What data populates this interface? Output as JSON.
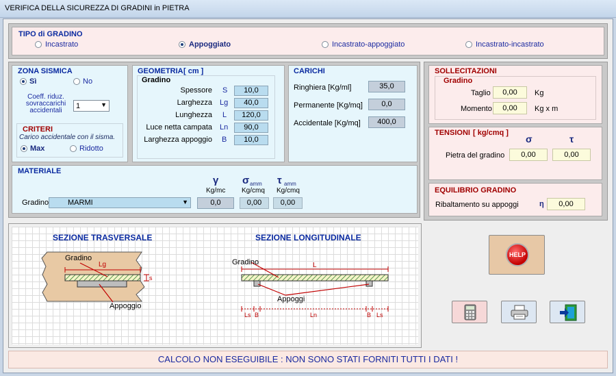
{
  "window": {
    "title": "VERIFICA DELLA SICUREZZA DI GRADINI in PIETRA"
  },
  "tipo": {
    "header": "TIPO di GRADINO",
    "options": [
      "Incastrato",
      "Appoggiato",
      "Incastrato-appoggiato",
      "Incastrato-incastrato"
    ],
    "selected": "Appoggiato"
  },
  "zona": {
    "header": "ZONA SISMICA",
    "si": "Sì",
    "no": "No",
    "coeff_label": "Coeff. riduz. sovraccarichi accidentali",
    "coeff_value": "1"
  },
  "criteri": {
    "header": "CRITERI",
    "subtitle": "Carico accidentale con il sisma.",
    "max": "Max",
    "ridotto": "Ridotto"
  },
  "geometria": {
    "header": "GEOMETRIA",
    "unit": "[ cm ]",
    "sub": "Gradino",
    "rows": [
      {
        "label": "Spessore",
        "sym": "S",
        "value": "10,0"
      },
      {
        "label": "Larghezza",
        "sym": "Lg",
        "value": "40,0"
      },
      {
        "label": "Lunghezza",
        "sym": "L",
        "value": "120,0"
      },
      {
        "label": "Luce netta campata",
        "sym": "Ln",
        "value": "90,0"
      },
      {
        "label": "Larghezza appoggio",
        "sym": "B",
        "value": "10,0"
      }
    ]
  },
  "carichi": {
    "header": "CARICHI",
    "rows": [
      {
        "label": "Ringhiera [Kg/ml]",
        "value": "35,0"
      },
      {
        "label": "Permanente [Kg/mq]",
        "value": "0,0"
      },
      {
        "label": "Accidentale [Kg/mq]",
        "value": "400,0"
      }
    ]
  },
  "materiale": {
    "header": "MATERIALE",
    "label": "Gradino",
    "value": "MARMI",
    "col1_sym": "γ",
    "col1_unit": "Kg/mc",
    "col2_sym": "σ",
    "col2_sub": "amm",
    "col2_unit": "Kg/cmq",
    "col3_sym": "τ",
    "col3_sub": "amm",
    "col3_unit": "Kg/cmq",
    "v1": "0,0",
    "v2": "0,00",
    "v3": "0,00"
  },
  "sollecitazioni": {
    "header": "SOLLECITAZIONI",
    "sub": "Gradino",
    "taglio_label": "Taglio",
    "taglio_value": "0,00",
    "taglio_unit": "Kg",
    "momento_label": "Momento",
    "momento_value": "0,00",
    "momento_unit": "Kg x m"
  },
  "tensioni": {
    "header": "TENSIONI",
    "unit": "[ kg/cmq ]",
    "sigma": "σ",
    "tau": "τ",
    "row_label": "Pietra del gradino",
    "sigma_value": "0,00",
    "tau_value": "0,00"
  },
  "equilibrio": {
    "header": "EQUILIBRIO GRADINO",
    "label": "Ribaltamento su appoggi",
    "sym": "η",
    "value": "0,00"
  },
  "diagram": {
    "trasv_title": "SEZIONE TRASVERSALE",
    "long_title": "SEZIONE LONGITUDINALE",
    "gradino": "Gradino",
    "appoggio": "Appoggio",
    "appoggi": "Appoggi",
    "lg": "Lg",
    "s": "s",
    "l": "L",
    "ls1": "Ls",
    "b1": "B",
    "ln": "Ln",
    "b2": "B",
    "ls2": "Ls"
  },
  "buttons": {
    "help": "HELP"
  },
  "status": "CALCOLO NON ESEGUIBILE : NON SONO STATI FORNITI TUTTI I DATI !"
}
